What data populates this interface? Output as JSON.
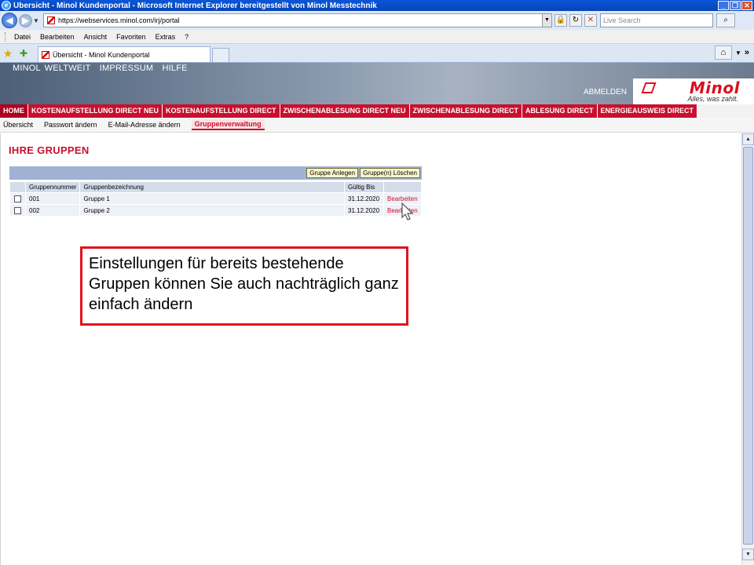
{
  "window": {
    "title": "Übersicht - Minol Kundenportal - Microsoft Internet Explorer bereitgestellt von Minol Messtechnik",
    "buttons": [
      "_",
      "❐",
      "✕"
    ]
  },
  "browser": {
    "url": "https://webservices.minol.com/irj/portal",
    "search_placeholder": "Live Search",
    "menu": [
      "Datei",
      "Bearbeiten",
      "Ansicht",
      "Favoriten",
      "Extras",
      "?"
    ],
    "tab_title": "Übersicht - Minol Kundenportal"
  },
  "portal": {
    "top_links": [
      "MINOL WELTWEIT",
      "IMPRESSUM",
      "HILFE"
    ],
    "logout": "ABMELDEN",
    "logo": "Minol",
    "slogan": "Alles, was zahlt.",
    "main_nav": [
      "HOME",
      "KOSTENAUFSTELLUNG DIRECT NEU",
      "KOSTENAUFSTELLUNG DIRECT",
      "ZWISCHENABLESUNG DIRECT NEU",
      "ZWISCHENABLESUNG DIRECT",
      "ABLESUNG DIRECT",
      "ENERGIEAUSWEIS DIRECT"
    ],
    "sub_nav": [
      "Übersicht",
      "Passwort ändern",
      "E-Mail-Adresse ändern",
      "Gruppenverwaltung"
    ]
  },
  "page": {
    "title": "IHRE GRUPPEN",
    "buttons": {
      "add": "Gruppe Anlegen",
      "delete": "Gruppe(n) Löschen"
    },
    "table": {
      "headers": [
        "Gruppennummer",
        "Gruppenbezeichnung",
        "Gültig Bis",
        ""
      ],
      "rows": [
        {
          "nummer": "001",
          "bezeichnung": "Gruppe 1",
          "gueltig": "31.12.2020",
          "action": "Bearbeiten"
        },
        {
          "nummer": "002",
          "bezeichnung": "Gruppe 2",
          "gueltig": "31.12.2020",
          "action": "Bearbeiten"
        }
      ]
    },
    "callout": "Einstellungen für bereits bestehende Gruppen können Sie auch nachträglich ganz einfach ändern"
  },
  "colors": {
    "accent_red": "#c8102e",
    "header_slate": "#6c7b90",
    "grid_header": "#9fb2d4"
  }
}
